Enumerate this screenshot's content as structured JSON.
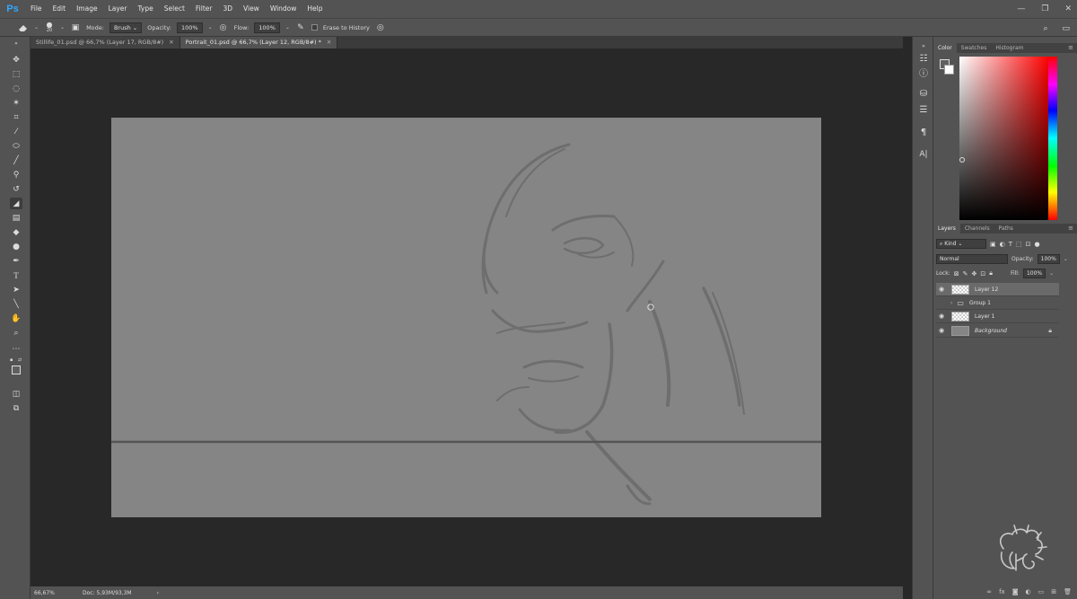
{
  "app": {
    "logo": "Ps"
  },
  "menu": [
    "File",
    "Edit",
    "Image",
    "Layer",
    "Type",
    "Select",
    "Filter",
    "3D",
    "View",
    "Window",
    "Help"
  ],
  "options": {
    "brush_size": "20",
    "mode_label": "Mode:",
    "mode_value": "Brush",
    "opacity_label": "Opacity:",
    "opacity_value": "100%",
    "flow_label": "Flow:",
    "flow_value": "100%",
    "erase_history_label": "Erase to History"
  },
  "tabs": [
    {
      "label": "Stillife_01.psd @ 66,7% (Layer 17, RGB/8#)",
      "active": false
    },
    {
      "label": "Portrait_01.psd @ 66,7% (Layer 12, RGB/8#) *",
      "active": true
    }
  ],
  "status": {
    "zoom": "66,67%",
    "doc": "Doc: 5,93M/93,3M",
    "arrow": "›"
  },
  "color_panel": {
    "tabs": [
      "Color",
      "Swatches",
      "Histogram"
    ],
    "fg_color": "#606060",
    "bg_color": "#ffffff"
  },
  "layers_panel": {
    "tabs": [
      "Layers",
      "Channels",
      "Paths"
    ],
    "filter_label": "Kind",
    "blend_mode": "Normal",
    "opacity_label": "Opacity:",
    "opacity_value": "100%",
    "lock_label": "Lock:",
    "fill_label": "Fill:",
    "fill_value": "100%",
    "layers": [
      {
        "name": "Layer 12",
        "type": "pixel",
        "visible": true,
        "active": true
      },
      {
        "name": "Group 1",
        "type": "group",
        "visible": false,
        "active": false
      },
      {
        "name": "Layer 1",
        "type": "pixel",
        "visible": true,
        "active": false
      },
      {
        "name": "Background",
        "type": "background",
        "visible": true,
        "active": false
      }
    ]
  },
  "colors": {
    "ui_bg": "#535353",
    "workspace": "#282828",
    "canvas": "#858585",
    "accent": "#31a8ff"
  }
}
